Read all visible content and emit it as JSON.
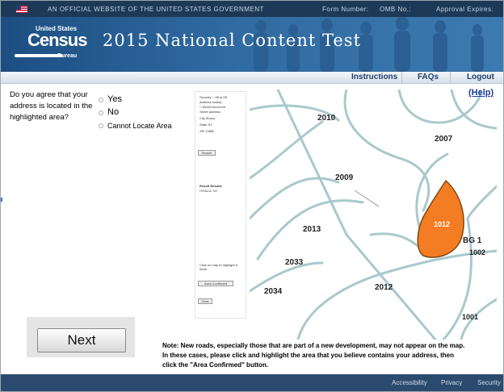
{
  "banner": {
    "text": "AN OFFICIAL WEBSITE OF THE UNITED STATES GOVERNMENT",
    "form_number": "Form Number:",
    "omb": "OMB No.:",
    "approval": "Approval Expires:"
  },
  "header": {
    "logo_us": "United States",
    "logo_census": "Census",
    "logo_bureau": "Bureau",
    "title": "2015 National Content Test"
  },
  "nav": {
    "instructions": "Instructions",
    "faqs": "FAQs",
    "logout": "Logout"
  },
  "help": "(Help)",
  "question": {
    "text": "Do you agree that your address is located in the highlighted area?",
    "options": [
      "Yes",
      "No",
      "Cannot Locate Area"
    ]
  },
  "snapshot": {
    "lines": [
      "Security  ○ Off  ● Off",
      "Address lookup",
      "□ Street Num/Unit",
      "Street address",
      "City  Ithaca",
      "State  NY",
      "ZIP  14850"
    ],
    "search_button": "Search",
    "result_title": "Result Results",
    "result_text": "ITHACA, NY",
    "instruction": "Click on map to highlight a block",
    "area_button": "Area Confirmed",
    "clear_button": "Clear"
  },
  "map": {
    "highlight_color": "#f47c22",
    "labels": [
      "2010",
      "2007",
      "2009",
      "1012",
      "BG 1",
      "1002",
      "2013",
      "2033",
      "2012",
      "2034",
      "1001"
    ]
  },
  "next_label": "Next",
  "note": "Note: New roads, especially those that are part of a new development, may not appear on the map.  In these cases, please click and highlight the area that you believe contains your address, then click the \"Area Confirmed\" button.",
  "footer": {
    "accessibility": "Accessibility",
    "privacy": "Privacy",
    "security": "Security"
  }
}
